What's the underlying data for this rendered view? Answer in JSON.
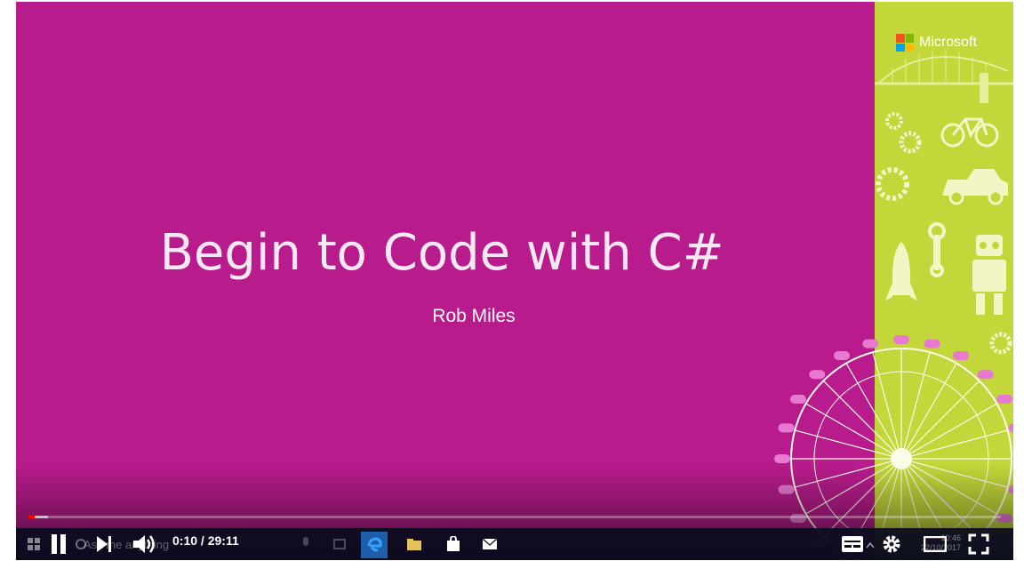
{
  "slide": {
    "title": "Begin to Code with C#",
    "author": "Rob Miles",
    "brand": "Microsoft",
    "background_color": "#b81c8c",
    "panel_color": "#c3d63a"
  },
  "player": {
    "current_time": "0:10",
    "duration": "29:11",
    "time_text": "0:10 / 29:11",
    "progress_fraction": 0.006,
    "buffered_fraction": 0.02,
    "controls": [
      "pause-icon",
      "next-icon",
      "volume-icon",
      "subtitles-icon",
      "settings-icon",
      "theater-mode-icon",
      "fullscreen-icon"
    ]
  },
  "taskbar": {
    "search_placeholder": "Ask me anything",
    "clock_time": "10:46",
    "clock_date": "22/10/2017",
    "icons": [
      "windows-start-icon",
      "cortana-icon",
      "microphone-icon",
      "task-view-icon",
      "edge-icon",
      "file-explorer-icon",
      "store-icon",
      "mail-icon"
    ]
  }
}
